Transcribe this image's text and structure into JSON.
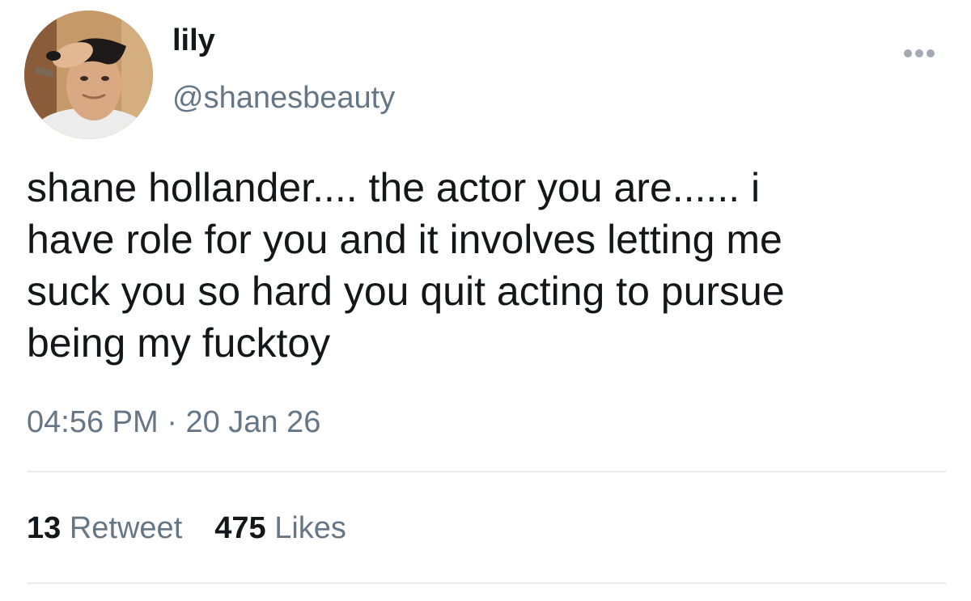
{
  "user": {
    "display_name": "lily",
    "handle": "@shanesbeauty",
    "avatar_icon": "profile-photo"
  },
  "tweet": {
    "lines": [
      "shane hollander.... the actor you are...... i",
      "have role for you and it involves letting me",
      "suck you so hard you quit acting to pursue",
      "being my fucktoy"
    ],
    "time": "04:56 PM",
    "separator": "·",
    "date": "20 Jan 26"
  },
  "stats": {
    "retweets_count": "13",
    "retweets_label": "Retweet",
    "likes_count": "475",
    "likes_label": "Likes"
  },
  "menu": {
    "icon": "more-dots-icon"
  },
  "colors": {
    "text_primary": "#14171a",
    "text_secondary": "#657786",
    "divider": "#e6ecf0",
    "more_dots": "#a2aab3"
  }
}
